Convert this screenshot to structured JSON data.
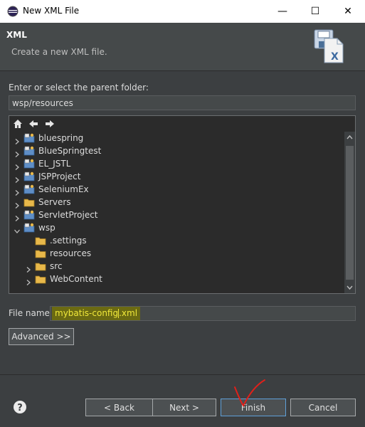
{
  "window": {
    "title": "New XML File",
    "controls": {
      "minimize": "—",
      "maximize": "☐",
      "close": "✕"
    }
  },
  "header": {
    "title": "XML",
    "description": "Create a new XML file.",
    "icon": "xml-file-wizard-icon"
  },
  "parent_folder": {
    "label": "Enter or select the parent folder:",
    "value": "wsp/resources"
  },
  "tree": {
    "toolbar": [
      "home-icon",
      "back-arrow-icon",
      "forward-arrow-icon"
    ],
    "items": [
      {
        "label": "bluespring",
        "depth": 0,
        "expanded": false,
        "type": "project"
      },
      {
        "label": "BlueSpringtest",
        "depth": 0,
        "expanded": false,
        "type": "project"
      },
      {
        "label": "EL_JSTL",
        "depth": 0,
        "expanded": false,
        "type": "project"
      },
      {
        "label": "JSPProject",
        "depth": 0,
        "expanded": false,
        "type": "project"
      },
      {
        "label": "SeleniumEx",
        "depth": 0,
        "expanded": false,
        "type": "project"
      },
      {
        "label": "Servers",
        "depth": 0,
        "expanded": false,
        "type": "folder"
      },
      {
        "label": "ServletProject",
        "depth": 0,
        "expanded": false,
        "type": "project"
      },
      {
        "label": "wsp",
        "depth": 0,
        "expanded": true,
        "type": "project"
      },
      {
        "label": ".settings",
        "depth": 1,
        "expanded": null,
        "type": "folder"
      },
      {
        "label": "resources",
        "depth": 1,
        "expanded": null,
        "type": "folder"
      },
      {
        "label": "src",
        "depth": 1,
        "expanded": false,
        "type": "folder"
      },
      {
        "label": "WebContent",
        "depth": 1,
        "expanded": false,
        "type": "folder"
      }
    ]
  },
  "file_name": {
    "label": "File name:",
    "value_before_caret": "mybatis-config",
    "value_after_caret": ".xml"
  },
  "buttons": {
    "advanced": "Advanced >>",
    "back": "< Back",
    "next": "Next >",
    "finish": "Finish",
    "cancel": "Cancel"
  },
  "colors": {
    "background": "#3c3f41",
    "highlight": "#6b6a12",
    "highlight_text": "#f0e83a",
    "annotation": "#e0201a"
  }
}
